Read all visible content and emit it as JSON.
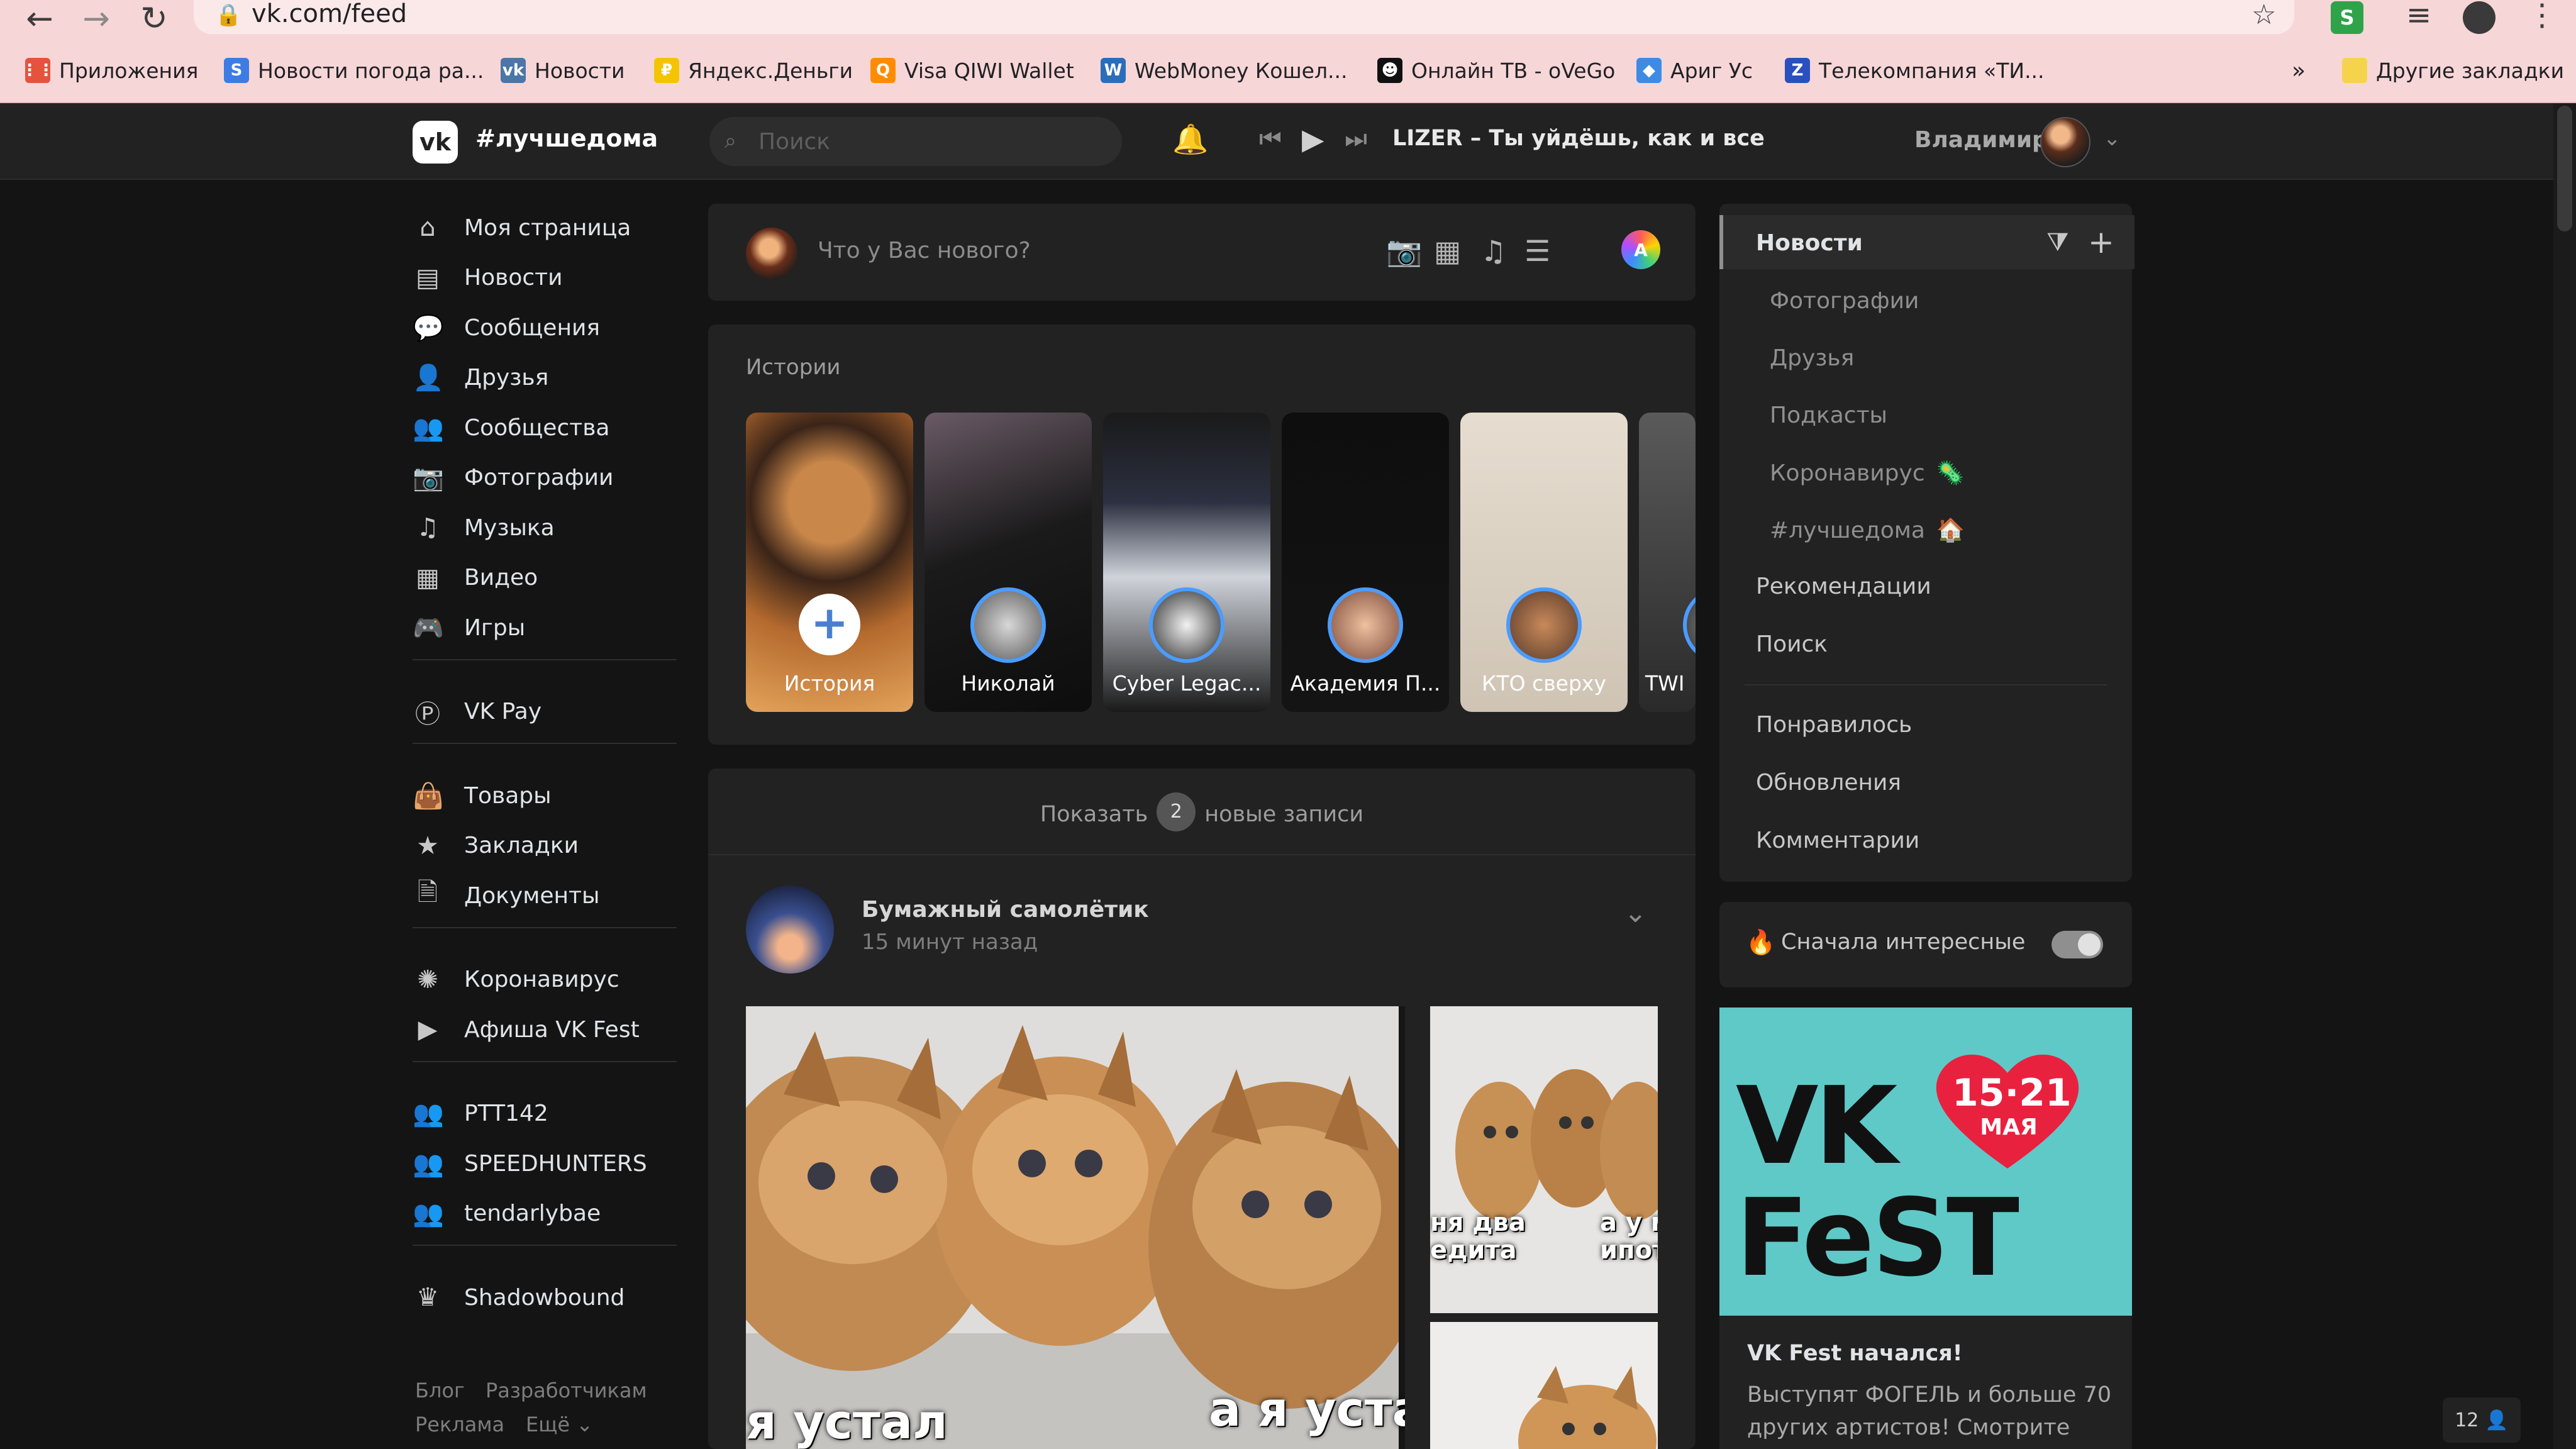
{
  "browser": {
    "url": "vk.com/feed",
    "bookmarks": [
      {
        "label": "Приложения",
        "icon": "apps-grid-icon",
        "color": "#e5533d"
      },
      {
        "label": "Новости погода ра...",
        "icon": "news-icon",
        "color": "#3d7be5"
      },
      {
        "label": "Новости",
        "icon": "vk-icon",
        "color": "#4a76a8"
      },
      {
        "label": "Яндекс.Деньги",
        "icon": "yandex-money-icon",
        "color": "#f5c400"
      },
      {
        "label": "Visa QIWI Wallet",
        "icon": "qiwi-icon",
        "color": "#ff8c00"
      },
      {
        "label": "WebMoney Кошел...",
        "icon": "webmoney-icon",
        "color": "#2a6ebb"
      },
      {
        "label": "Онлайн ТВ - oVeGo",
        "icon": "alien-icon",
        "color": "#111111"
      },
      {
        "label": "Ариг Ус",
        "icon": "diamond-icon",
        "color": "#3d8be5"
      },
      {
        "label": "Телекомпания «ТИ...",
        "icon": "tv-company-icon",
        "color": "#2a4fbf"
      }
    ],
    "other_bookmarks": "Другие закладки",
    "more_label": "»"
  },
  "header": {
    "tag": "#лучшедома",
    "search_placeholder": "Поиск",
    "track": "LIZER – Ты уйдёшь, как и все",
    "user": "Владимир"
  },
  "sidebar": {
    "groups": [
      [
        {
          "label": "Моя страница",
          "icon": "home-icon"
        },
        {
          "label": "Новости",
          "icon": "news-icon"
        },
        {
          "label": "Сообщения",
          "icon": "messages-icon"
        },
        {
          "label": "Друзья",
          "icon": "friend-icon"
        },
        {
          "label": "Сообщества",
          "icon": "communities-icon"
        },
        {
          "label": "Фотографии",
          "icon": "camera-icon"
        },
        {
          "label": "Музыка",
          "icon": "music-icon"
        },
        {
          "label": "Видео",
          "icon": "video-icon"
        },
        {
          "label": "Игры",
          "icon": "gamepad-icon"
        }
      ],
      [
        {
          "label": "VK Pay",
          "icon": "vk-pay-icon"
        }
      ],
      [
        {
          "label": "Товары",
          "icon": "shopping-bag-icon"
        },
        {
          "label": "Закладки",
          "icon": "star-icon"
        },
        {
          "label": "Документы",
          "icon": "document-icon"
        }
      ],
      [
        {
          "label": "Коронавирус",
          "icon": "virus-icon"
        },
        {
          "label": "Афиша VK Fest",
          "icon": "vk-fest-icon"
        }
      ],
      [
        {
          "label": "PTT142",
          "icon": "group-icon"
        },
        {
          "label": "SPEEDHUNTERS",
          "icon": "group-icon"
        },
        {
          "label": "tendarlybae",
          "icon": "group-icon"
        }
      ],
      [
        {
          "label": "Shadowbound",
          "icon": "crown-icon"
        }
      ]
    ],
    "footer": {
      "blog": "Блог",
      "developers": "Разработчикам",
      "ads": "Реклама",
      "more": "Ещё ⌄"
    }
  },
  "composer": {
    "placeholder": "Что у Вас нового?"
  },
  "stories": {
    "title": "Истории",
    "items": [
      {
        "label": "История",
        "kind": "add"
      },
      {
        "label": "Николай",
        "kind": "user"
      },
      {
        "label": "Cyber Legac...",
        "kind": "user"
      },
      {
        "label": "Академия П...",
        "kind": "user"
      },
      {
        "label": "КТО сверху",
        "kind": "user"
      },
      {
        "label": "TWI",
        "kind": "user"
      }
    ]
  },
  "feed": {
    "show_prefix": "Показать",
    "new_count": "2",
    "show_suffix": "новые записи",
    "post": {
      "author": "Бумажный самолётик",
      "time": "15 минут назад",
      "captions": {
        "main": "я устал",
        "main_right": "а я устал",
        "side_top_left": "ня два\nедита",
        "side_top_right": "а у м\nипот"
      }
    }
  },
  "right_nav": {
    "news": "Новости",
    "subs": [
      {
        "label": "Фотографии"
      },
      {
        "label": "Друзья"
      },
      {
        "label": "Подкасты"
      },
      {
        "label": "Коронавирус",
        "emoji": "🦠"
      },
      {
        "label": "#лучшедома",
        "emoji": "🏠"
      }
    ],
    "recommendations": "Рекомендации",
    "search": "Поиск",
    "liked": "Понравилось",
    "updates": "Обновления",
    "comments": "Комментарии",
    "interesting_first": "Сначала интересные",
    "interesting_on": true
  },
  "promo": {
    "vk": "VK",
    "fest": "FeST",
    "dates": "15·21",
    "month": "МАЯ",
    "title": "VK Fest начался!",
    "text": "Выступят ФОГЕЛЬ и больше 70 других артистов! Смотрите"
  },
  "corner_badge": "12",
  "colors": {
    "page_bg": "#141414",
    "card_bg": "#222222",
    "chrome_bg": "#f7d6d8",
    "fest_bg": "#5fc9c8",
    "heart_red": "#e8213f"
  }
}
